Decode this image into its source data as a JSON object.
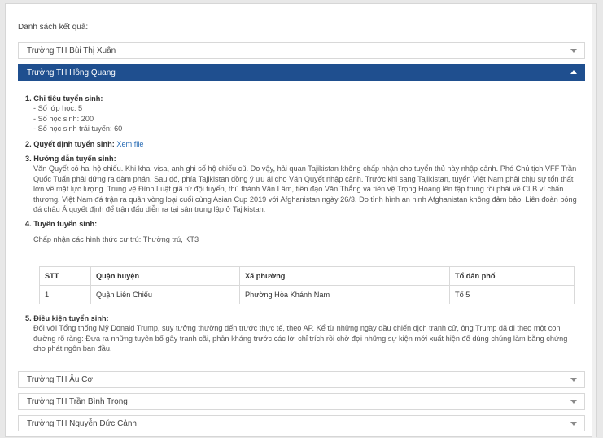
{
  "results_title": "Danh sách kết quả:",
  "schools": [
    {
      "name": "Trường TH Bùi Thị Xuân"
    },
    {
      "name": "Trường TH Hồng Quang"
    },
    {
      "name": "Trường TH Âu Cơ"
    },
    {
      "name": "Trường TH Trần Bình Trọng"
    },
    {
      "name": "Trường TH Nguyễn Đức Cảnh"
    }
  ],
  "detail": {
    "s1_title": "1. Chỉ tiêu tuyển sinh:",
    "s1_items": [
      "- Số lớp học: 5",
      "- Số học sinh: 200",
      "- Số học sinh trái tuyến: 60"
    ],
    "s2_title": "2. Quyết định tuyển sinh:",
    "s2_link": "Xem file",
    "s3_title": "3. Hướng dẫn tuyển sinh:",
    "s3_text": "Văn Quyết có hai hộ chiếu. Khi khai visa, anh ghi số hộ chiếu cũ. Do vậy, hải quan Tajikistan không chấp nhận cho tuyển thủ này nhập cảnh. Phó Chủ tịch VFF Trần Quốc Tuấn phải đứng ra đàm phán. Sau đó, phía Tajikistan đồng ý ưu ái cho Văn Quyết nhập cảnh. Trước khi sang Tajikistan, tuyển Việt Nam phải chịu sự tổn thất lớn về mặt lực lượng. Trung vệ Đình Luật giã từ đội tuyển, thủ thành Văn Lâm, tiền đạo Văn Thắng và tiền vệ Trọng Hoàng lên tập trung rồi phải về CLB vì chấn thương. Việt Nam đá trận ra quân vòng loại cuối cùng Asian Cup 2019 với Afghanistan ngày 26/3. Do tình hình an ninh Afghanistan không đảm bảo, Liên đoàn bóng đá châu Á quyết định để trận đấu diễn ra tại sân trung lập ở Tajikistan.",
    "s4_title": "4. Tuyến tuyển sinh:",
    "s4_text": "Chấp nhận các hình thức cư trú: Thường trú, KT3",
    "table_headers": [
      "STT",
      "Quận huyện",
      "Xã phường",
      "Tổ dân phố"
    ],
    "table_rows": [
      [
        "1",
        "Quận Liên Chiểu",
        "Phường Hòa Khánh Nam",
        "Tổ 5"
      ]
    ],
    "s5_title": "5. Điều kiện tuyển sinh:",
    "s5_text": "Đối với Tổng thống Mỹ Donald Trump, suy tưởng thường đến trước thực tế, theo AP. Kể từ những ngày đầu chiến dịch tranh cử, ông Trump đã đi theo một con đường rõ ràng: Đưa ra những tuyên bố gây tranh cãi, phản kháng trước các lời chỉ trích rồi chờ đợi những sự kiện mới xuất hiện để dùng chúng làm bằng chứng cho phát ngôn ban đầu."
  }
}
